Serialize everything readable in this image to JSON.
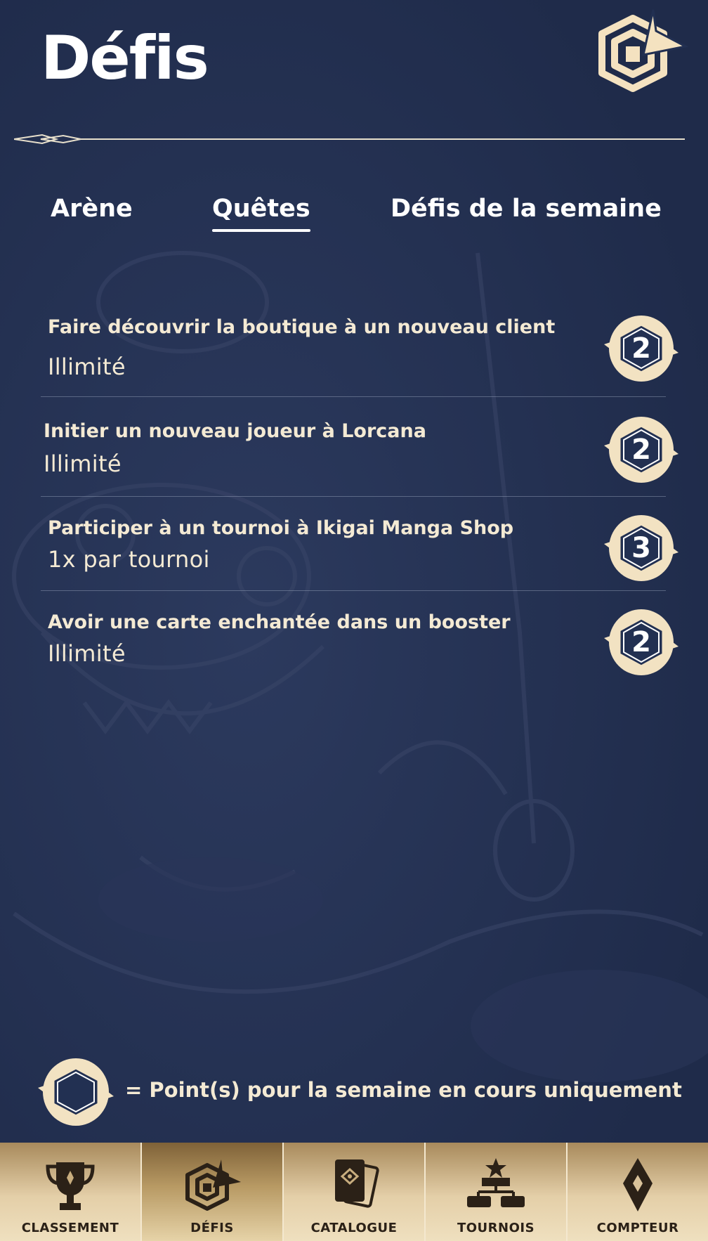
{
  "header": {
    "title": "Défis",
    "logo_icon": "lorcana-challenge-logo-icon"
  },
  "tabs": [
    {
      "label": "Arène",
      "active": false
    },
    {
      "label": "Quêtes",
      "active": true
    },
    {
      "label": "Défis de la semaine",
      "active": false
    }
  ],
  "quests": [
    {
      "title": "Faire découvrir la boutique à un nouveau client",
      "frequency": "Illimité",
      "points": "2"
    },
    {
      "title": "Initier un nouveau joueur à Lorcana",
      "frequency": "Illimité",
      "points": "2"
    },
    {
      "title": "Participer à un tournoi à Ikigai Manga Shop",
      "frequency": "1x par tournoi",
      "points": "3"
    },
    {
      "title": "Avoir une carte enchantée dans un booster",
      "frequency": "Illimité",
      "points": "2"
    }
  ],
  "legend": {
    "text": "= Point(s) pour la semaine en cours uniquement"
  },
  "bottom_nav": [
    {
      "label": "CLASSEMENT",
      "icon": "trophy-icon",
      "active": false
    },
    {
      "label": "DÉFIS",
      "icon": "challenge-logo-icon",
      "active": true
    },
    {
      "label": "CATALOGUE",
      "icon": "card-catalogue-icon",
      "active": false
    },
    {
      "label": "TOURNOIS",
      "icon": "tournament-bracket-icon",
      "active": false
    },
    {
      "label": "COMPTEUR",
      "icon": "lore-counter-icon",
      "active": false
    }
  ],
  "colors": {
    "background": "#223052",
    "accent_cream": "#f4ead4",
    "nav_gold": "#d9c29a"
  }
}
